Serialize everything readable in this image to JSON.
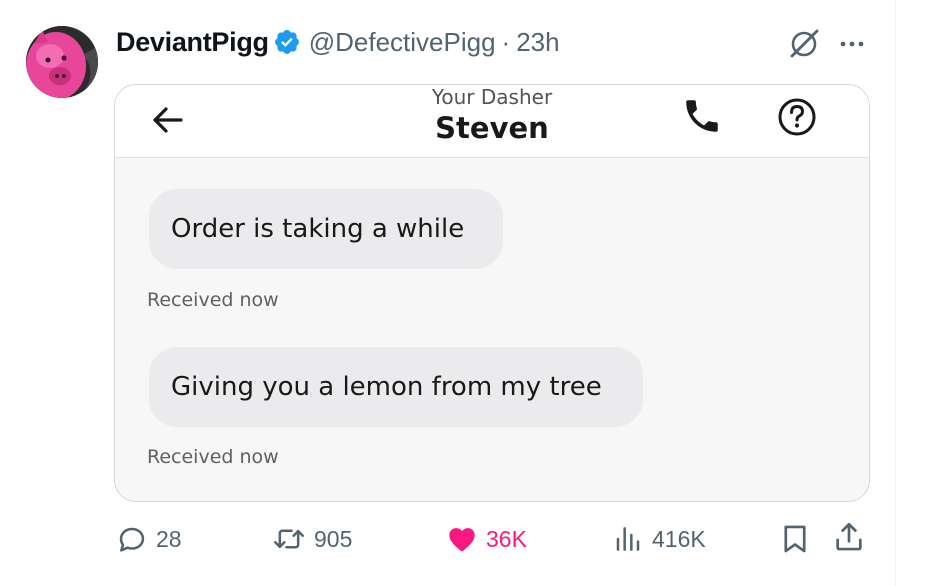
{
  "tweet": {
    "display_name": "DeviantPigg",
    "handle": "@DefectivePigg",
    "separator": "·",
    "time": "23h",
    "verified": true,
    "colors": {
      "verified_blue": "#1d9bf0",
      "like_pink": "#f91880",
      "muted_text": "#536471"
    }
  },
  "icons": {
    "verified": "verified-badge-icon",
    "grok": "grok-icon",
    "more": "more-options-icon",
    "reply": "reply-icon",
    "repost": "repost-icon",
    "like": "heart-icon",
    "views": "views-icon",
    "bookmark": "bookmark-icon",
    "share": "share-icon"
  },
  "media": {
    "chat_header": {
      "subtitle": "Your Dasher",
      "name": "Steven"
    },
    "messages": [
      {
        "text": "Order is taking a while",
        "status": "Received now"
      },
      {
        "text": "Giving you a lemon from my tree",
        "status": "Received now"
      }
    ]
  },
  "actions": {
    "replies": "28",
    "reposts": "905",
    "likes": "36K",
    "views": "416K"
  }
}
